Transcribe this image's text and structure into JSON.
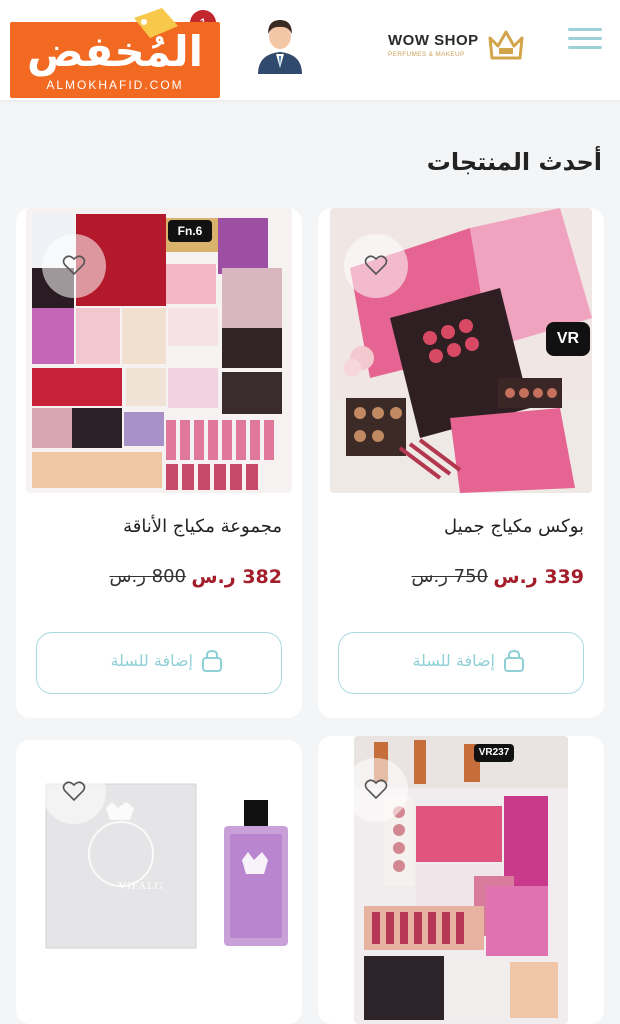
{
  "header": {
    "brand_name": "WOW SHOP",
    "brand_tagline": "PERFUMES & MAKEUP",
    "cart_count": "1",
    "menu_icon": "hamburger-menu-icon",
    "account_icon": "user-avatar-icon"
  },
  "watermark": {
    "text_ar": "المُخفض",
    "text_en": "ALMOKHAFID.COM"
  },
  "section": {
    "title": "أحدث المنتجات"
  },
  "products": [
    {
      "title": "بوكس مكياج جميل",
      "price": "339 ر.س",
      "old_price": "750 ر.س",
      "badge": "VR",
      "add_label": "إضافة للسلة"
    },
    {
      "title": "مجموعة مكياج الأناقة",
      "price": "382 ر.س",
      "old_price": "800 ر.س",
      "badge": "Fn.6",
      "add_label": "إضافة للسلة"
    },
    {
      "badge": "VR237"
    },
    {
      "box_text": "VIFALG"
    }
  ],
  "colors": {
    "accent": "#9ccfd6",
    "price": "#a31e2a",
    "watermark": "#f26a21",
    "badge": "#c2272d"
  }
}
